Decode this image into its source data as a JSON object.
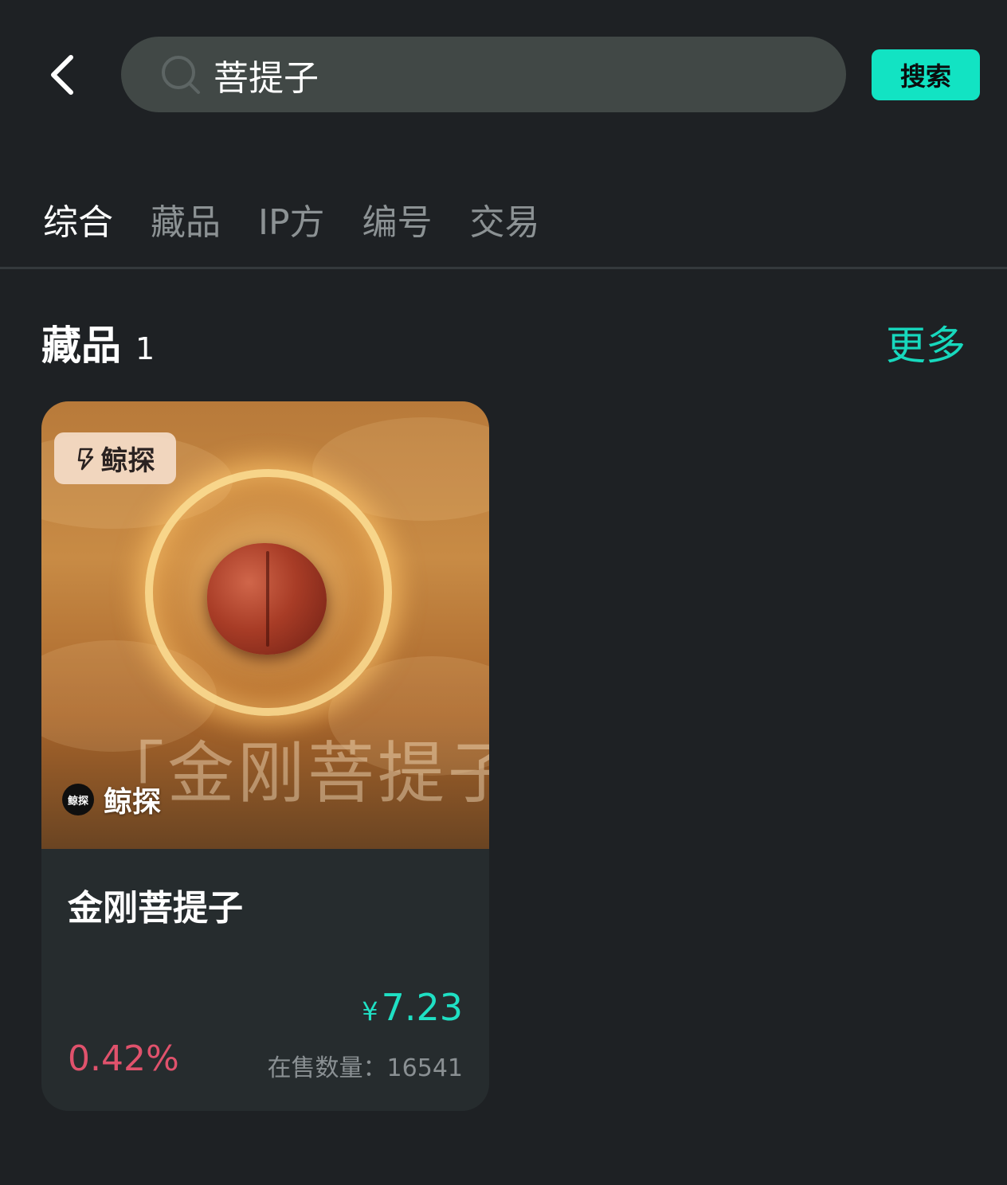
{
  "header": {
    "search_value": "菩提子",
    "search_button": "搜索"
  },
  "tabs": [
    {
      "label": "综合",
      "active": true
    },
    {
      "label": "藏品",
      "active": false
    },
    {
      "label": "IP方",
      "active": false
    },
    {
      "label": "编号",
      "active": false
    },
    {
      "label": "交易",
      "active": false
    }
  ],
  "section": {
    "title": "藏品",
    "count": "1",
    "more": "更多"
  },
  "card": {
    "badge": "鲸探",
    "art_title": "「金刚菩提子」",
    "brand_logo_text": "鲸探",
    "brand_name": "鲸探",
    "title": "金刚菩提子",
    "price_currency": "¥",
    "price": "7.23",
    "change": "0.42%",
    "stock_text": "在售数量：16541"
  },
  "colors": {
    "accent": "#12e3c3",
    "price": "#1fe0c4",
    "change_up": "#e0526c",
    "background": "#1e2124",
    "card_background": "#262c2e"
  },
  "icons": {
    "back": "chevron-left-icon",
    "search": "search-icon",
    "badge": "lightning-icon"
  }
}
